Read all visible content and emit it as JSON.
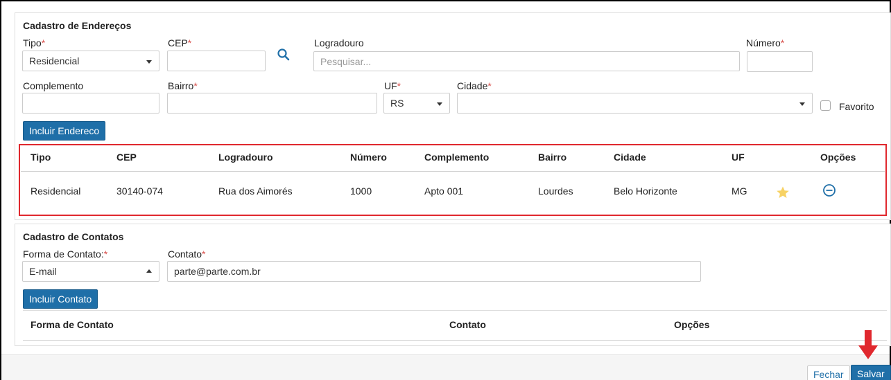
{
  "enderecos": {
    "title": "Cadastro de Endereços",
    "tipo_label": "Tipo",
    "tipo_value": "Residencial",
    "cep_label": "CEP",
    "cep_value": "",
    "logradouro_label": "Logradouro",
    "logradouro_placeholder": "Pesquisar...",
    "numero_label": "Número",
    "numero_value": "",
    "complemento_label": "Complemento",
    "bairro_label": "Bairro",
    "uf_label": "UF",
    "uf_value": "RS",
    "cidade_label": "Cidade",
    "cidade_value": "",
    "favorito_label": "Favorito",
    "required_mark": "*",
    "incluir_button": "Incluir Endereco",
    "table": {
      "headers": [
        "Tipo",
        "CEP",
        "Logradouro",
        "Número",
        "Complemento",
        "Bairro",
        "Cidade",
        "UF",
        "Opções"
      ],
      "rows": [
        [
          "Residencial",
          "30140-074",
          "Rua dos Aimorés",
          "1000",
          "Apto 001",
          "Lourdes",
          "Belo Horizonte",
          "MG"
        ]
      ],
      "highlight_color": "#e0282e",
      "star_color": "#f7d264",
      "remove_color": "#1f6fa8"
    }
  },
  "contatos": {
    "title": "Cadastro de Contatos",
    "forma_label": "Forma de Contato:",
    "forma_value": "E-mail",
    "contato_label": "Contato",
    "contato_value": "parte@parte.com.br",
    "incluir_button": "Incluir Contato",
    "table": {
      "headers": [
        "Forma de Contato",
        "Contato",
        "Opções"
      ]
    }
  },
  "footer": {
    "fechar": "Fechar",
    "salvar": "Salvar",
    "arrow_color": "#e0282e"
  },
  "colors": {
    "primary": "#1f6fa8",
    "required": "#d9534f"
  }
}
